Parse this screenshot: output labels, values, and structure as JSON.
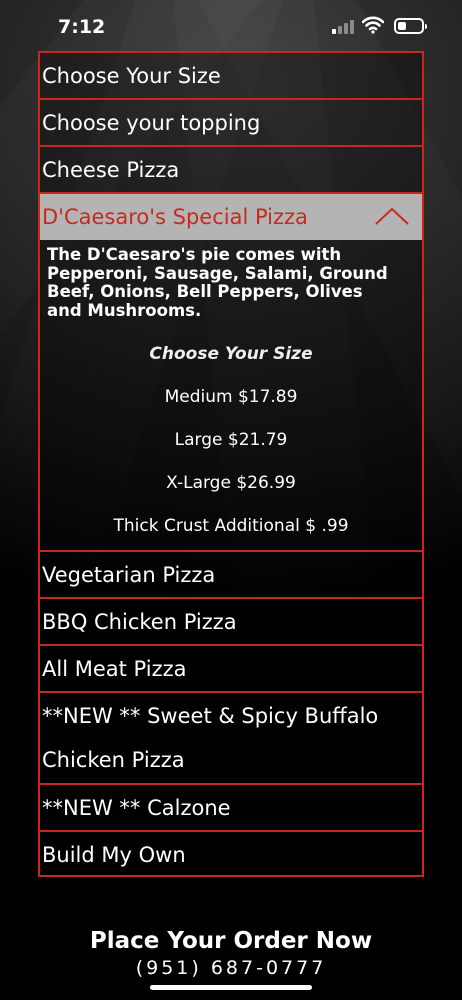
{
  "status": {
    "time": "7:12"
  },
  "menu": {
    "items_top": [
      "Choose Your Size",
      "Choose your topping",
      "Cheese Pizza"
    ],
    "expanded": {
      "title": "D'Caesaro's Special Pizza",
      "description": "The D'Caesaro's pie comes with Pepperoni, Sausage, Salami, Ground Beef, Onions, Bell Peppers, Olives and Mushrooms.",
      "size_heading": "Choose Your Size",
      "prices": [
        "Medium $17.89",
        "Large $21.79",
        "X-Large $26.99",
        "Thick Crust Additional $ .99"
      ]
    },
    "items_bottom": [
      "Vegetarian Pizza",
      "BBQ Chicken Pizza",
      "All Meat Pizza"
    ],
    "buffalo": {
      "line1": "**NEW ** Sweet & Spicy Buffalo",
      "line2": "Chicken Pizza"
    },
    "items_end": [
      "**NEW ** Calzone",
      "Build My Own"
    ]
  },
  "footer": {
    "cta": "Place Your Order Now",
    "phone": "(951) 687-0777"
  },
  "colors": {
    "accent": "#c9261f",
    "expanded_bg": "#b4b4b4"
  },
  "icons": [
    "chevron-up-icon",
    "signal-icon",
    "wifi-icon",
    "battery-icon"
  ]
}
